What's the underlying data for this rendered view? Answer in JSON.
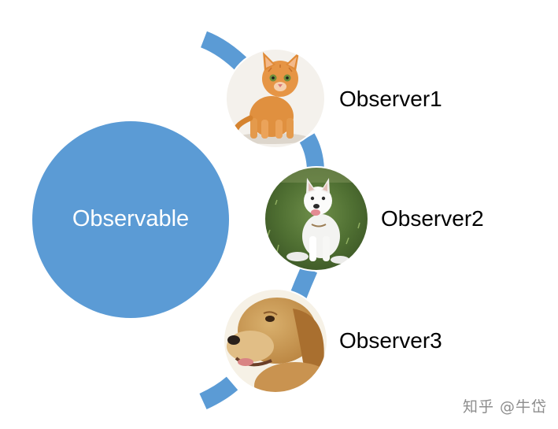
{
  "subject": {
    "label": "Observable",
    "color": "#5b9bd5"
  },
  "observers": [
    {
      "label": "Observer1",
      "icon": "kitten-photo"
    },
    {
      "label": "Observer2",
      "icon": "white-puppy-photo"
    },
    {
      "label": "Observer3",
      "icon": "golden-retriever-photo"
    }
  ],
  "watermark": "知乎 @牛岱",
  "colors": {
    "arc": "#5b9bd5",
    "circle": "#5b9bd5",
    "text": "#000000",
    "subject_text": "#ffffff",
    "watermark": "#8d8d8d"
  }
}
